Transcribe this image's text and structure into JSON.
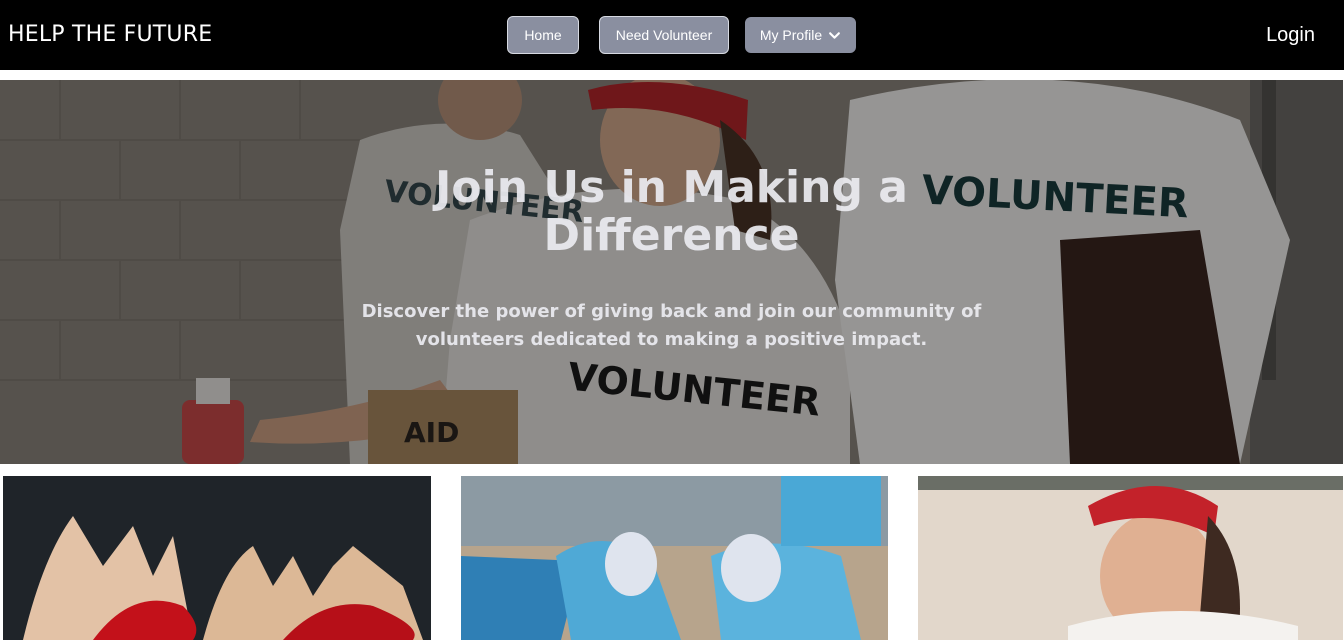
{
  "navbar": {
    "brand": "HELP THE FUTURE",
    "links": {
      "home": "Home",
      "need_volunteer": "Need Volunteer",
      "my_profile": "My Profile"
    },
    "login": "Login"
  },
  "hero": {
    "title_line1": "Join Us in Making a",
    "title_line2": "Difference",
    "subtitle_line1": "Discover the power of giving back and join our community of",
    "subtitle_line2": "volunteers dedicated to making a positive impact.",
    "shirt_text": "VOLUNTEER",
    "box_text": "AID"
  },
  "icons": {
    "profile_dropdown": "chevron-down-icon"
  },
  "colors": {
    "navbar_bg": "#000000",
    "nav_button_bg": "#8a8fa0",
    "text_light": "#ffffff"
  }
}
